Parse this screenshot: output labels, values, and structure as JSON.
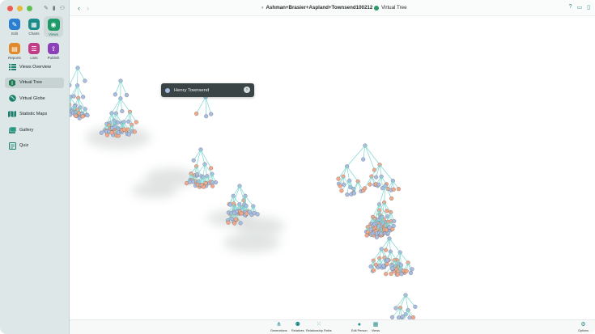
{
  "window": {
    "document_title": "Ashman+Brasier+Aspland+Townsend100212",
    "view_title": "Virtual Tree"
  },
  "sidebar": {
    "apps": [
      {
        "label": "Edit",
        "icon": "pencil-icon",
        "color": "#2b7fd0"
      },
      {
        "label": "Charts",
        "icon": "charts-icon",
        "color": "#1c8c8a"
      },
      {
        "label": "Views",
        "icon": "eye-icon",
        "color": "#1f9b6a"
      },
      {
        "label": "Reports",
        "icon": "reports-icon",
        "color": "#e08a2c"
      },
      {
        "label": "Lists",
        "icon": "lists-icon",
        "color": "#c23d86"
      },
      {
        "label": "Publish",
        "icon": "publish-icon",
        "color": "#8b3fb8"
      }
    ],
    "nav": [
      {
        "label": "Views Overview",
        "icon": "views-overview-icon"
      },
      {
        "label": "Virtual Tree",
        "icon": "virtual-tree-icon"
      },
      {
        "label": "Virtual Globe",
        "icon": "virtual-globe-icon"
      },
      {
        "label": "Statistic Maps",
        "icon": "statistic-maps-icon"
      },
      {
        "label": "Gallery",
        "icon": "gallery-icon"
      },
      {
        "label": "Quiz",
        "icon": "quiz-icon"
      }
    ]
  },
  "popup": {
    "person_name": "Henry Townsend"
  },
  "bottombar": {
    "items": [
      {
        "label": "Generations",
        "icon": "generations-icon"
      },
      {
        "label": "Relatives",
        "icon": "relatives-icon"
      },
      {
        "label": "Relationship Paths",
        "icon": "relationship-paths-icon"
      },
      {
        "label": "Edit Person",
        "icon": "edit-person-icon"
      },
      {
        "label": "Views",
        "icon": "views-icon"
      },
      {
        "label": "Options",
        "icon": "options-icon"
      }
    ]
  },
  "colors": {
    "accent": "#1c8a88",
    "male_node": "#a9bde3",
    "female_node": "#f2a88a",
    "edge": "#7fd6d0"
  }
}
